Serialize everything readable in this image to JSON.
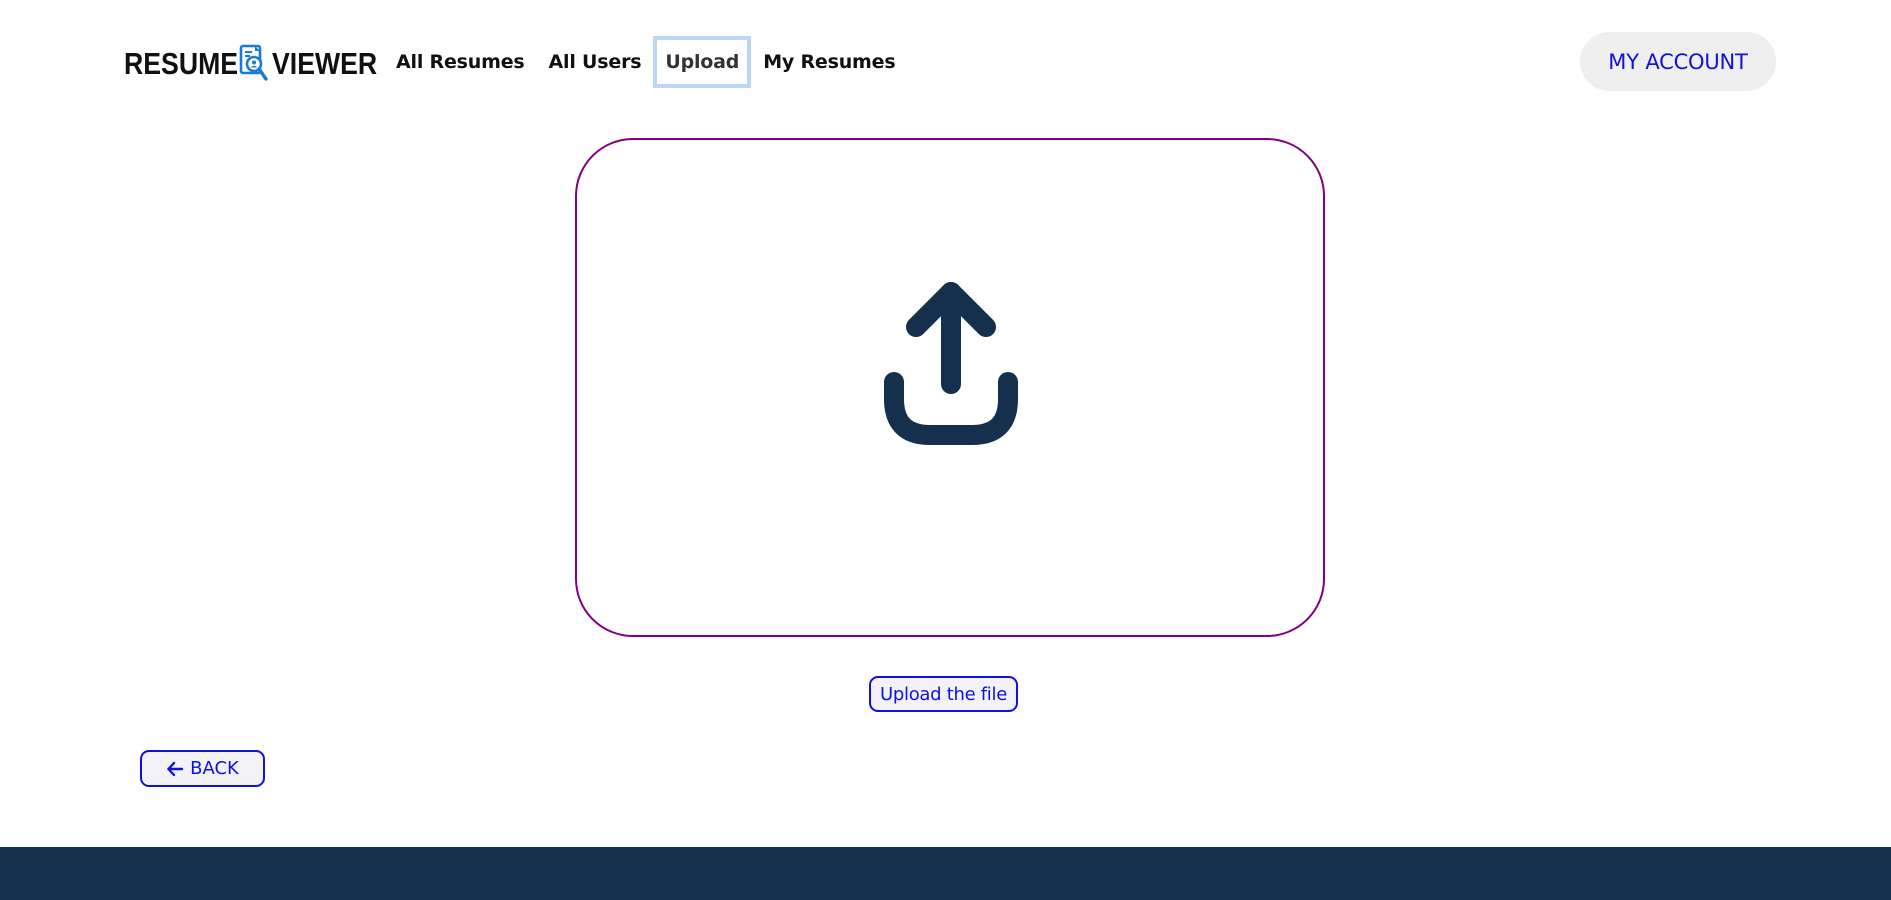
{
  "header": {
    "logo": {
      "word_left": "RESUME",
      "word_right": "VIEWER",
      "icon": "document-magnifier-icon"
    },
    "nav": [
      {
        "label": "All Resumes",
        "active": false
      },
      {
        "label": "All Users",
        "active": false
      },
      {
        "label": "Upload",
        "active": true
      },
      {
        "label": "My Resumes",
        "active": false
      }
    ],
    "account_label": "MY ACCOUNT"
  },
  "upload": {
    "icon": "upload-icon",
    "button_label": "Upload the file"
  },
  "back": {
    "icon": "arrow-left-icon",
    "label": "BACK"
  },
  "colors": {
    "nav_text": "#111111",
    "accent_blue": "#1111dd",
    "dropzone_border": "#800080",
    "icon_navy": "#15304d",
    "footer": "#15304d",
    "active_outline": "#bcd7f5",
    "account_bg": "#efefef"
  }
}
